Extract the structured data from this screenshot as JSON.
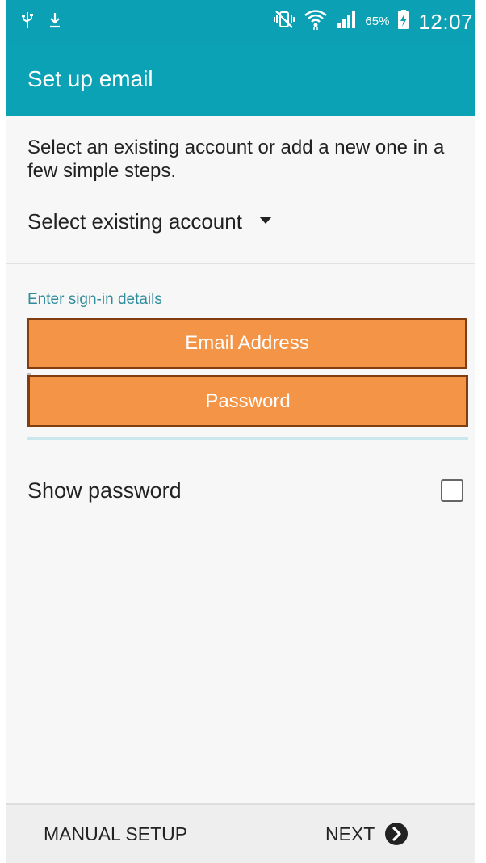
{
  "status_bar": {
    "battery_percent": "65%",
    "time": "12:07",
    "icons": [
      "usb-icon",
      "download-icon",
      "mute-vibrate-icon",
      "wifi-icon",
      "signal-icon",
      "battery-charging-icon"
    ]
  },
  "app_bar": {
    "title": "Set up email"
  },
  "intro": {
    "text": "Select an existing account or add a new one in a few simple steps."
  },
  "account_select": {
    "label": "Select existing account",
    "icon": "dropdown-arrow-icon"
  },
  "signin": {
    "section_label": "Enter sign-in details",
    "email_label": "Email Address",
    "password_label": "Password"
  },
  "show_password": {
    "label": "Show password",
    "checked": false
  },
  "bottom": {
    "manual_setup_label": "MANUAL SETUP",
    "next_label": "NEXT",
    "next_icon": "chevron-right-circle-icon"
  },
  "colors": {
    "accent": "#0aa2b4",
    "highlight": "#f39447",
    "highlight_border": "#7f3d10",
    "section_label": "#2f8c9a"
  }
}
